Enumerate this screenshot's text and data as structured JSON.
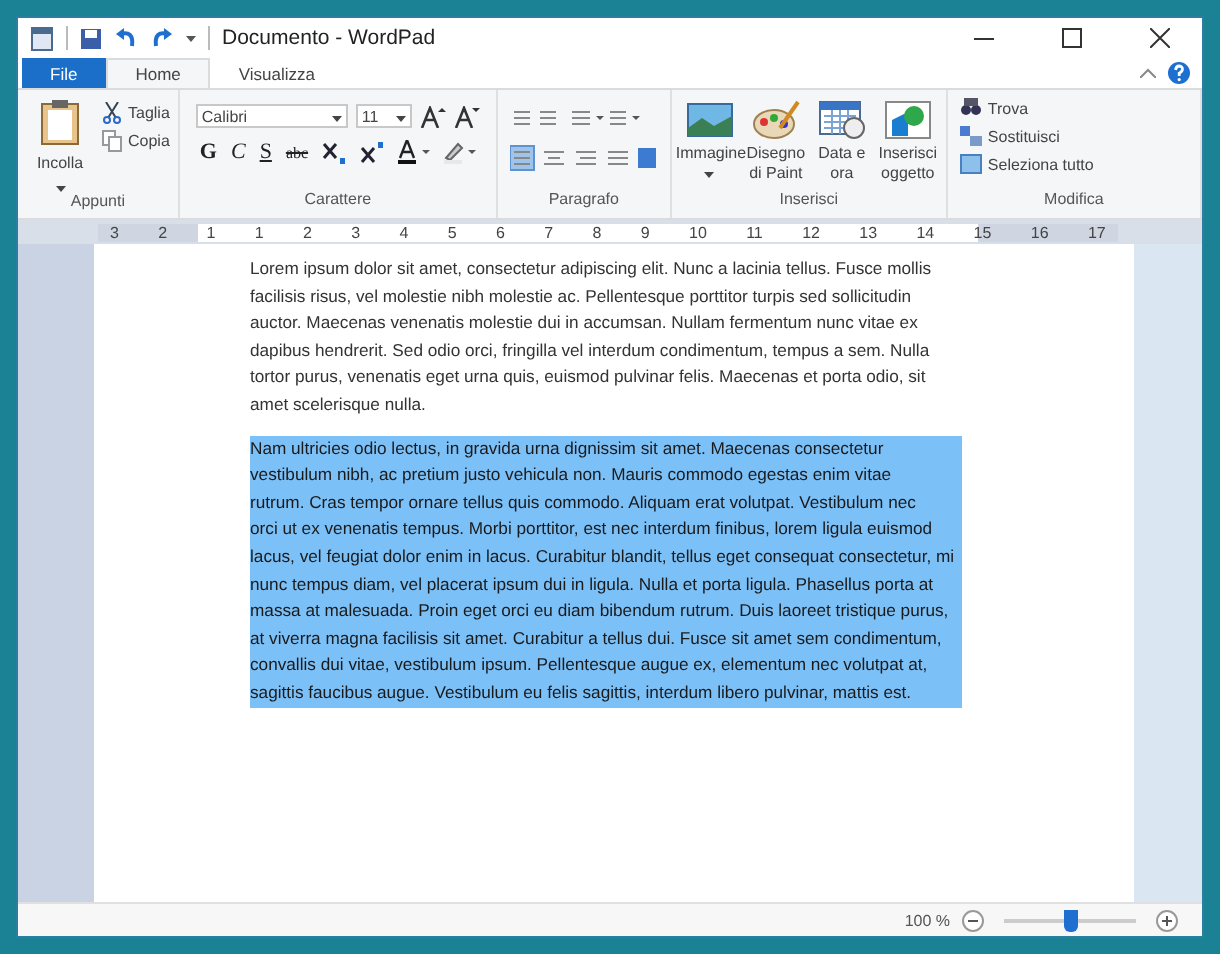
{
  "window": {
    "title": "Documento - WordPad"
  },
  "tabs": [
    {
      "label": "File",
      "kind": "file",
      "selected": false
    },
    {
      "label": "Home",
      "kind": "tab",
      "selected": true
    },
    {
      "label": "Visualizza",
      "kind": "tab",
      "selected": false
    }
  ],
  "ribbon": {
    "clipboard": {
      "paste": "Incolla",
      "cut": "Taglia",
      "copy": "Copia",
      "label": "Appunti"
    },
    "font": {
      "family": "Calibri",
      "size": "11",
      "bold": "G",
      "italic": "C",
      "underline": "S",
      "strike": "abc",
      "label": "Carattere"
    },
    "paragraph": {
      "label": "Paragrafo"
    },
    "insert": {
      "items": [
        "Immagine",
        "Disegno di Paint",
        "Data e ora",
        "Inserisci oggetto"
      ],
      "label": "Inserisci"
    },
    "edit": {
      "items": [
        "Trova",
        "Sostituisci",
        "Seleziona tutto"
      ],
      "label": "Modifica"
    }
  },
  "ruler": {
    "labels": [
      "3",
      "2",
      "1",
      "1",
      "2",
      "3",
      "4",
      "5",
      "6",
      "7",
      "8",
      "9",
      "10",
      "11",
      "12",
      "13",
      "14",
      "15",
      "16",
      "17"
    ]
  },
  "document": {
    "paragraphs": [
      {
        "selected": false,
        "lines": [
          "Lorem ipsum dolor sit amet, consectetur adipiscing elit. Nunc a lacinia tellus. Fusce mollis",
          "facilisis risus, vel molestie nibh molestie ac. Pellentesque porttitor turpis sed sollicitudin",
          "auctor. Maecenas venenatis molestie dui in accumsan. Nullam fermentum nunc vitae ex",
          "dapibus hendrerit. Sed odio orci, fringilla vel interdum condimentum, tempus a sem. Nulla",
          "tortor purus, venenatis eget urna quis, euismod pulvinar felis. Maecenas et porta odio, sit",
          "amet scelerisque nulla."
        ]
      },
      {
        "selected": true,
        "lines": [
          "Nam ultricies odio lectus, in gravida urna dignissim sit amet. Maecenas consectetur",
          "vestibulum nibh, ac pretium justo vehicula non. Mauris commodo egestas enim vitae",
          "rutrum. Cras tempor ornare tellus quis commodo. Aliquam erat volutpat. Vestibulum nec",
          "orci ut ex venenatis tempus. Morbi porttitor, est nec interdum finibus, lorem ligula euismod",
          "lacus, vel feugiat dolor enim in lacus. Curabitur blandit, tellus eget consequat consectetur, mi",
          "nunc tempus diam, vel placerat ipsum dui in ligula. Nulla et porta ligula. Phasellus porta at",
          "massa at malesuada. Proin eget orci eu diam bibendum rutrum. Duis laoreet tristique purus,",
          "at viverra magna facilisis sit amet. Curabitur a tellus dui. Fusce sit amet sem condimentum,",
          "convallis dui vitae, vestibulum ipsum. Pellentesque augue ex, elementum nec volutpat at,",
          "sagittis faucibus augue. Vestibulum eu felis sagittis, interdum libero pulvinar, mattis est."
        ]
      }
    ]
  },
  "status_bar": {
    "zoom": "100 %",
    "zoom_slider": {
      "level": 0.5
    }
  }
}
